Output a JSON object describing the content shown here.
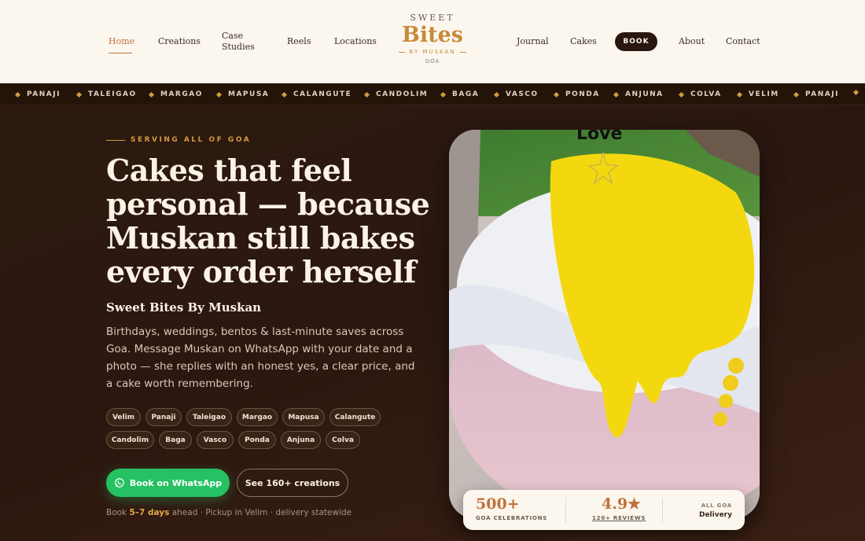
{
  "nav": {
    "items": [
      "Home",
      "Creations",
      "Case Studies",
      "Reels",
      "Locations",
      "Journal",
      "Cakes",
      "BOOK",
      "About",
      "Contact"
    ],
    "case_line1": "Case",
    "case_line2": "Studies"
  },
  "logo": {
    "top": "SWEET",
    "main": "Bites",
    "sub": "BY MUSKAN",
    "region": "GOA"
  },
  "ticker": [
    "PANAJI",
    "TALEIGAO",
    "MARGAO",
    "MAPUSA",
    "CALANGUTE",
    "CANDOLIM",
    "BAGA",
    "VASCO",
    "PONDA",
    "ANJUNA",
    "COLVA",
    "VELIM",
    "PANAJI"
  ],
  "hero": {
    "eyebrow": "SERVING ALL OF GOA",
    "headline_l1": "Cakes that feel",
    "headline_l2": "personal — because",
    "headline_l3": "Muskan still bakes",
    "headline_l4": "every order herself",
    "brand": "Sweet Bites By Muskan",
    "description": "Birthdays, weddings, bentos & last-minute saves across Goa. Message Muskan on WhatsApp with your date and a photo — she replies with an honest yes, a clear price, and a cake worth remembering.",
    "chips_row1": [
      "Velim",
      "Panaji",
      "Taleigao",
      "Margao",
      "Mapusa",
      "Calangute"
    ],
    "chips_row2": [
      "Candolim",
      "Baga",
      "Vasco",
      "Ponda",
      "Anjuna",
      "Colva"
    ],
    "btn_whatsapp": "Book on WhatsApp",
    "btn_see": "See 160+ creations",
    "note_pre": "Book ",
    "note_hl": "5–7 days",
    "note_post": " ahead · Pickup in Velim · delivery statewide"
  },
  "image": {
    "caption_text": "Love"
  },
  "stats": {
    "s1_num": "500+",
    "s1_lbl": "GOA CELEBRATIONS",
    "s2_num": "4.9★",
    "s2_lbl": "120+ REVIEWS",
    "s3_top": "ALL GOA",
    "s3_bottom": "Delivery"
  },
  "colors": {
    "accent": "#c2703a",
    "gold": "#d69a3c",
    "whatsapp": "#25c162",
    "dark": "#2a1710"
  }
}
